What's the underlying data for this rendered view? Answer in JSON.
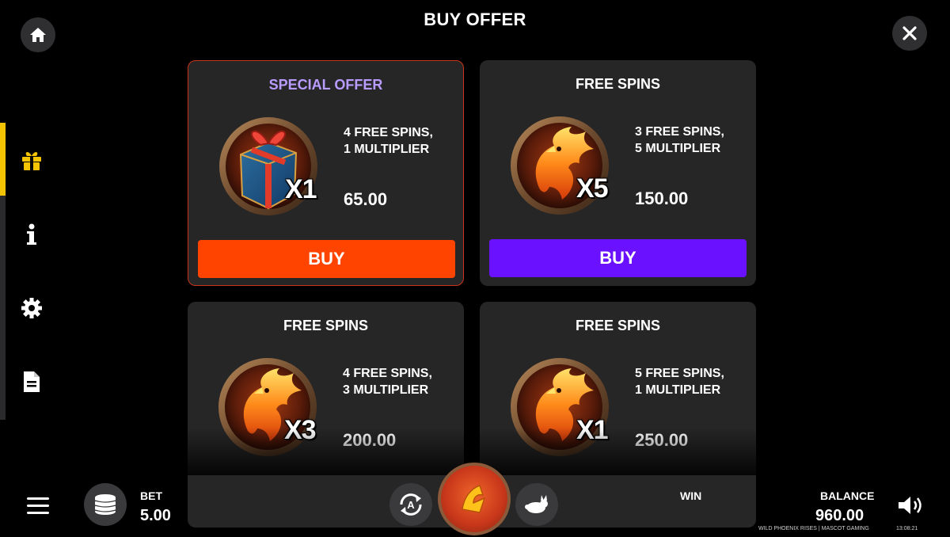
{
  "header": {
    "title": "BUY OFFER"
  },
  "offers": [
    {
      "title": "SPECIAL OFFER",
      "line1": "4 FREE SPINS,",
      "line2": "1 MULTIPLIER",
      "price": "65.00",
      "badge": "X1",
      "button": "BUY",
      "button_color": "#ff4400",
      "title_color": "#b99cff",
      "icon": "gift-icon"
    },
    {
      "title": "FREE SPINS",
      "line1": "3 FREE SPINS,",
      "line2": "5 MULTIPLIER",
      "price": "150.00",
      "badge": "X5",
      "button": "BUY",
      "button_color": "#6a12ff",
      "title_color": "#ffffff",
      "icon": "phoenix-icon"
    },
    {
      "title": "FREE SPINS",
      "line1": "4 FREE SPINS,",
      "line2": "3 MULTIPLIER",
      "price": "200.00",
      "badge": "X3",
      "icon": "phoenix-icon"
    },
    {
      "title": "FREE SPINS",
      "line1": "5 FREE SPINS,",
      "line2": "1 MULTIPLIER",
      "price": "250.00",
      "badge": "X1",
      "icon": "phoenix-icon"
    }
  ],
  "sidebar": {
    "icons": [
      "gift-icon",
      "info-icon",
      "gear-icon",
      "document-icon"
    ],
    "active": "gift-icon",
    "accent": "#f4c400"
  },
  "footer": {
    "bet_label": "BET",
    "bet_value": "5.00",
    "win_label": "WIN",
    "balance_label": "BALANCE",
    "balance_value": "960.00",
    "credits": "WILD PHOENIX RISES | MASCOT GAMING",
    "clock": "13:08:21"
  }
}
